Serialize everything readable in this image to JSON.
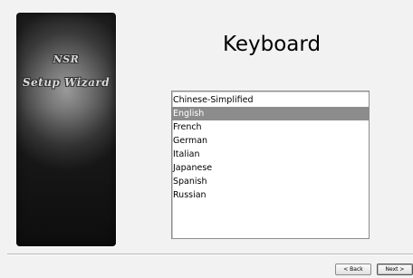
{
  "wizard": {
    "brand_line1": "NSR",
    "brand_line2": "Setup Wizard"
  },
  "page": {
    "title": "Keyboard"
  },
  "keyboard_list": {
    "items": [
      "Chinese-Simplified",
      "English",
      "French",
      "German",
      "Italian",
      "Japanese",
      "Spanish",
      "Russian"
    ],
    "selected": "English"
  },
  "footer": {
    "back_label": "< Back",
    "next_label": "Next >"
  },
  "colors": {
    "selection_bg": "#8c8c8c",
    "window_bg": "#f2f2f2"
  }
}
